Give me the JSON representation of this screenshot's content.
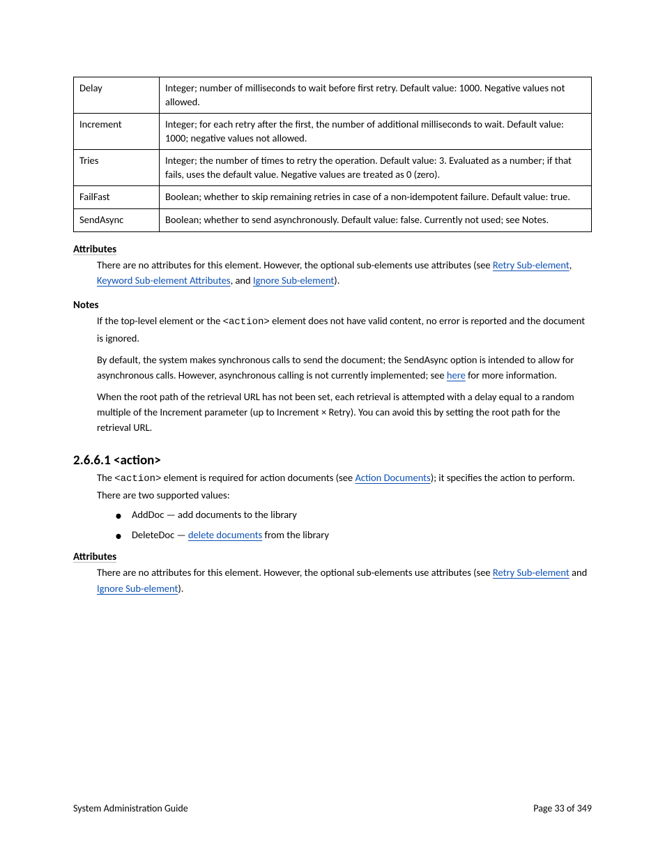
{
  "table": {
    "rows": [
      {
        "name": "Delay",
        "desc": "Integer; number of milliseconds to wait before first retry. Default value: 1000. Negative values not allowed."
      },
      {
        "name": "Increment",
        "desc": "Integer; for each retry after the first, the number of additional milliseconds to wait. Default value: 1000; negative values not allowed."
      },
      {
        "name": "Tries",
        "desc": "Integer; the number of times to retry the operation. Default value: 3. Evaluated as a number; if that fails, uses the default value. Negative values are treated as 0 (zero)."
      },
      {
        "name": "FailFast",
        "desc": "Boolean; whether to skip remaining retries in case of a non-idempotent failure. Default value: true."
      },
      {
        "name": "SendAsync",
        "desc": "Boolean; whether to send asynchronously. Default value: false. Currently not used; see Notes."
      }
    ]
  },
  "attr_h": "Attributes",
  "attr_body": "There are no attributes for this element. However, the optional sub-elements use attributes (see ",
  "attr_link1": {
    "text": "Retry Sub-element",
    "after": ", "
  },
  "attr_link2": {
    "text": "Keyword Sub-element Attributes",
    "after": ", and "
  },
  "attr_link3": {
    "text": "Ignore Sub-element",
    "after": ")."
  },
  "notes_h": "Notes",
  "notes_body_pre_mono": "If the top-level element or the ",
  "notes_mono": "<action>",
  "notes_body_post_mono": " element does not have valid content, no error is reported and the document is ignored.",
  "notes_body2_pre": "By default, the system makes synchronous calls to send the document; the SendAsync option is intended to allow for asynchronous calls. However, asynchronous calling is not currently implemented; see ",
  "notes_body2_link": "here",
  "notes_body2_post": " for more information.",
  "notes_body3": "When the root path of the retrieval URL has not been set, each retrieval is attempted with a delay equal to a random multiple of the Increment parameter (up to Increment × Retry). You can avoid this by setting the root path for the retrieval URL.",
  "section_h": "2.6.6.1 <action>",
  "section_desc_pre": "The ",
  "section_desc_mono": "<action>",
  "section_desc_post": " element is required for action documents (see ",
  "section_desc_link": "Action Documents",
  "section_desc_post2": "); it specifies the action to perform. There are two supported values:",
  "bullets": [
    {
      "pre": "AddDoc — add documents to the library",
      "link": "",
      "post": ""
    },
    {
      "pre": "DeleteDoc — ",
      "link": "delete documents",
      "post": " from the library"
    }
  ],
  "attr2_h": "Attributes",
  "attr2_body": "There are no attributes for this element. However, the optional sub-elements use attributes (see ",
  "attr2_link1": {
    "text": "Retry Sub-element",
    "after": " and "
  },
  "attr2_link2": {
    "text": "Ignore Sub-element",
    "after": ")."
  },
  "footer_left": "System Administration Guide",
  "footer_right": "Page 33 of 349"
}
